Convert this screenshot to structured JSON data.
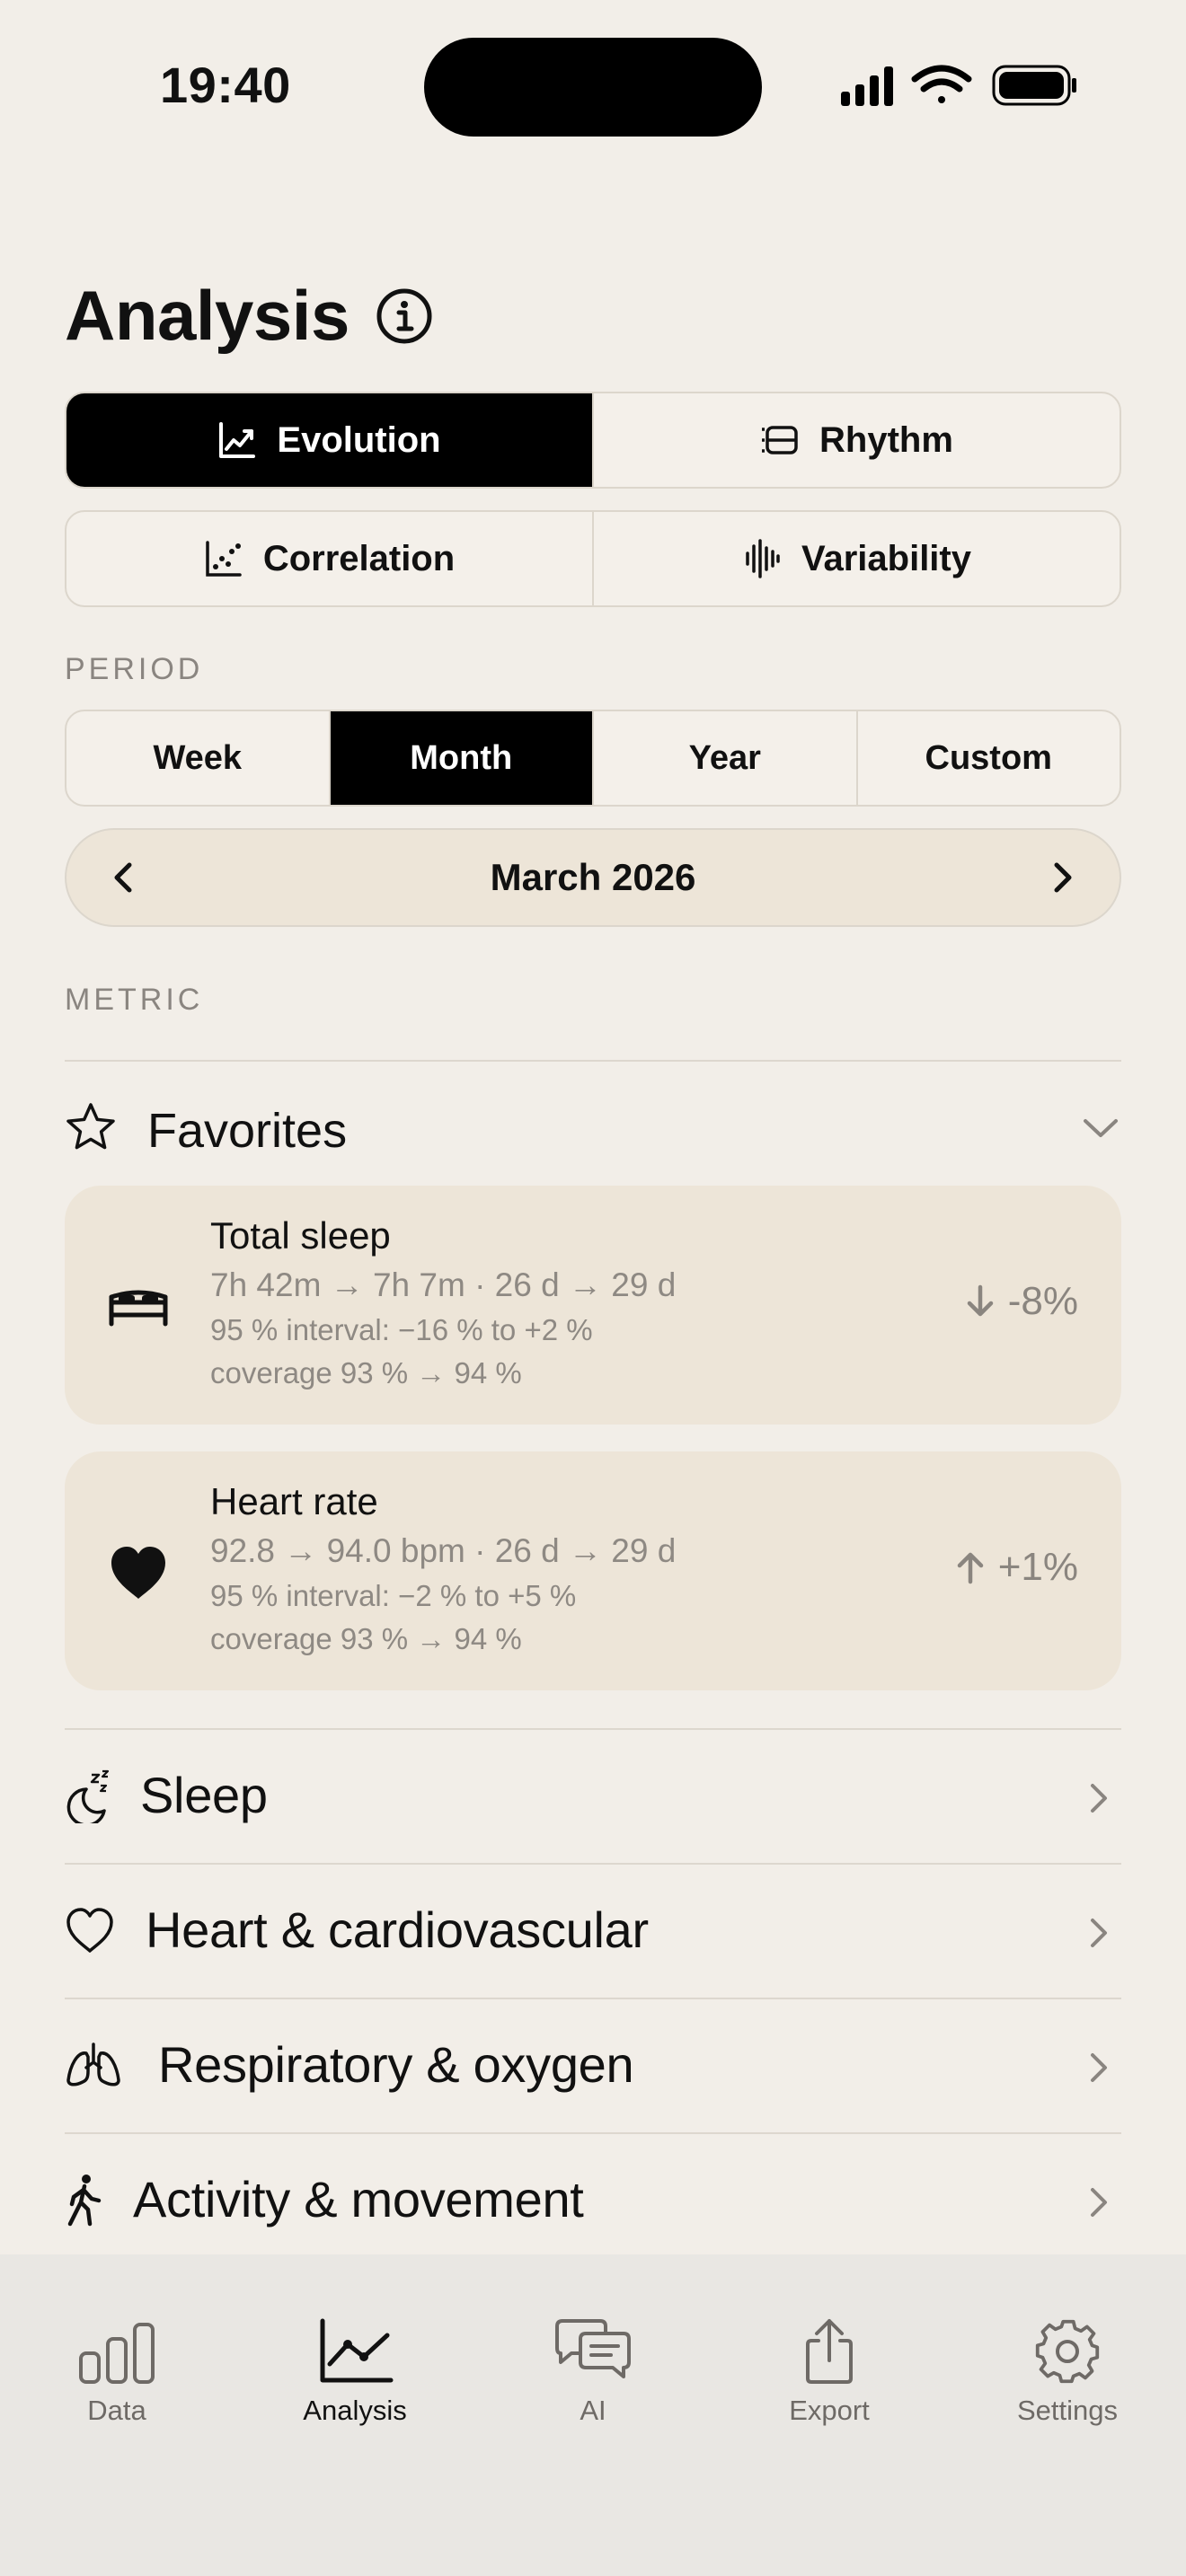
{
  "status_bar": {
    "time": "19:40"
  },
  "header": {
    "title": "Analysis"
  },
  "view_tabs": {
    "evolution": "Evolution",
    "rhythm": "Rhythm",
    "correlation": "Correlation",
    "variability": "Variability",
    "selected": "Evolution"
  },
  "period": {
    "label": "PERIOD",
    "options": [
      "Week",
      "Month",
      "Year",
      "Custom"
    ],
    "selected": "Month",
    "current": "March 2026"
  },
  "metric": {
    "label": "METRIC",
    "favorites_label": "Favorites",
    "cards": [
      {
        "name": "Total sleep",
        "line1": "7h 42m → 7h 7m · 26 d → 29 d",
        "line2": "95 % interval: −16 % to +2 %",
        "line3": "coverage 93 % → 94 %",
        "delta": "-8%",
        "direction": "down",
        "icon": "bed-icon"
      },
      {
        "name": "Heart rate",
        "line1": "92.8 → 94.0 bpm · 26 d → 29 d",
        "line2": "95 % interval: −2 % to +5 %",
        "line3": "coverage 93 % → 94 %",
        "delta": "+1%",
        "direction": "up",
        "icon": "heart-filled-icon"
      }
    ],
    "categories": [
      {
        "label": "Sleep",
        "icon": "moon-zzz-icon"
      },
      {
        "label": "Heart & cardiovascular",
        "icon": "heart-outline-icon"
      },
      {
        "label": "Respiratory & oxygen",
        "icon": "lungs-icon"
      },
      {
        "label": "Activity & movement",
        "icon": "walking-figure-icon"
      }
    ]
  },
  "tab_bar": {
    "items": [
      {
        "label": "Data",
        "icon": "bar-chart-icon"
      },
      {
        "label": "Analysis",
        "icon": "line-chart-icon"
      },
      {
        "label": "AI",
        "icon": "chat-bubbles-icon"
      },
      {
        "label": "Export",
        "icon": "share-icon"
      },
      {
        "label": "Settings",
        "icon": "gear-icon"
      }
    ],
    "selected": "Analysis"
  },
  "colors": {
    "background": "#F2EEE8",
    "card": "#EDE5D8",
    "active_segment": "#000000",
    "muted_text": "#8E8983"
  }
}
